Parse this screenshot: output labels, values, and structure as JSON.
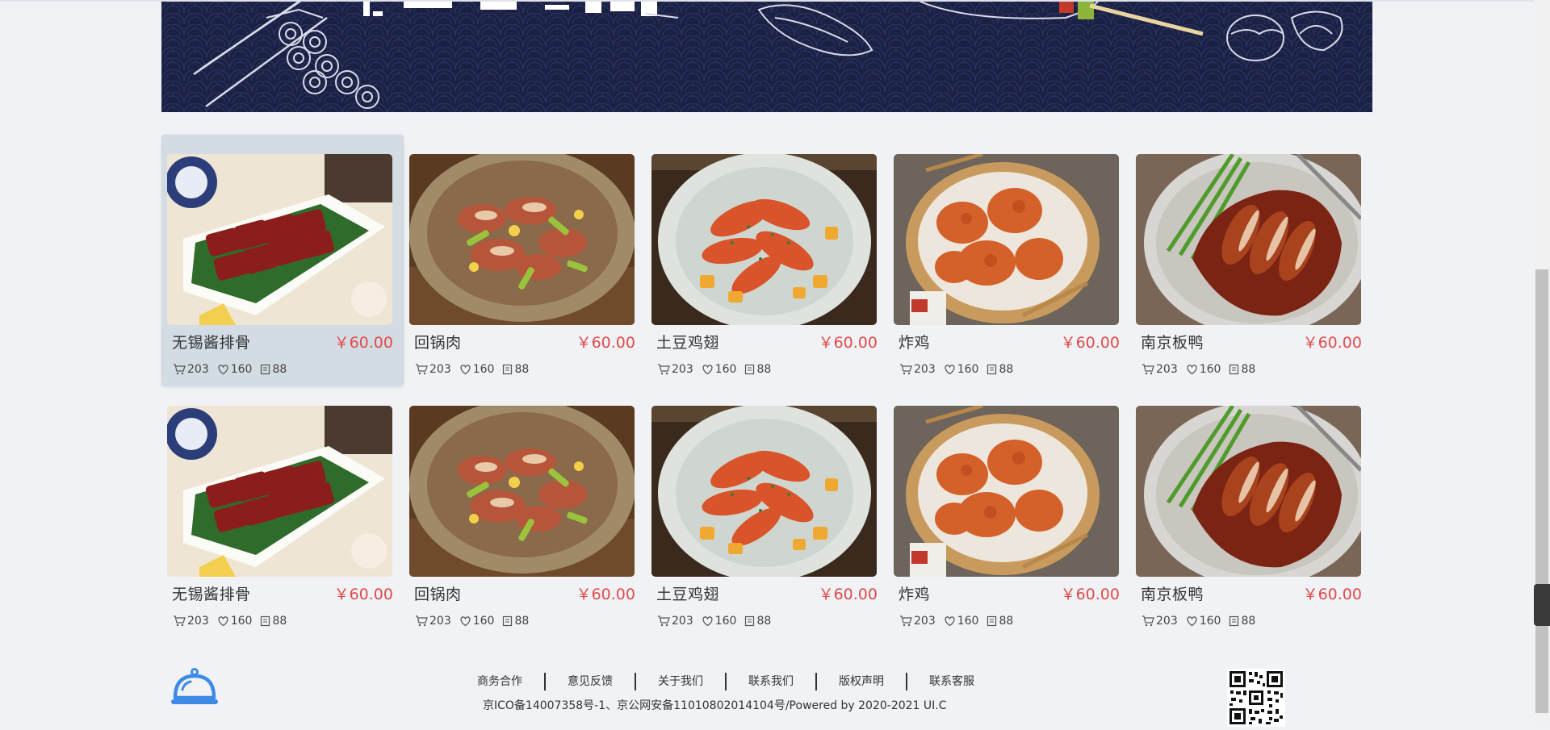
{
  "colors": {
    "price": "#e04b4b",
    "banner_bg": "#1b2143",
    "selected_card_bg": "#d3dbe3",
    "bell": "#3e8be6"
  },
  "products_row1": [
    {
      "name": "无锡酱排骨",
      "price": "￥60.00",
      "cart": "203",
      "likes": "160",
      "comments": "88",
      "image": "braised-ribs-photo"
    },
    {
      "name": "回锅肉",
      "price": "￥60.00",
      "cart": "203",
      "likes": "160",
      "comments": "88",
      "image": "twice-cooked-pork-photo"
    },
    {
      "name": "土豆鸡翅",
      "price": "￥60.00",
      "cart": "203",
      "likes": "160",
      "comments": "88",
      "image": "chicken-wings-potato-photo"
    },
    {
      "name": "炸鸡",
      "price": "￥60.00",
      "cart": "203",
      "likes": "160",
      "comments": "88",
      "image": "fried-chicken-photo"
    },
    {
      "name": "南京板鸭",
      "price": "￥60.00",
      "cart": "203",
      "likes": "160",
      "comments": "88",
      "image": "nanjing-duck-photo"
    }
  ],
  "products_row2": [
    {
      "name": "无锡酱排骨",
      "price": "￥60.00",
      "cart": "203",
      "likes": "160",
      "comments": "88",
      "image": "braised-ribs-photo"
    },
    {
      "name": "回锅肉",
      "price": "￥60.00",
      "cart": "203",
      "likes": "160",
      "comments": "88",
      "image": "twice-cooked-pork-photo"
    },
    {
      "name": "土豆鸡翅",
      "price": "￥60.00",
      "cart": "203",
      "likes": "160",
      "comments": "88",
      "image": "chicken-wings-potato-photo"
    },
    {
      "name": "炸鸡",
      "price": "￥60.00",
      "cart": "203",
      "likes": "160",
      "comments": "88",
      "image": "fried-chicken-photo"
    },
    {
      "name": "南京板鸭",
      "price": "￥60.00",
      "cart": "203",
      "likes": "160",
      "comments": "88",
      "image": "nanjing-duck-photo"
    }
  ],
  "footer": {
    "links": [
      "商务合作",
      "意见反馈",
      "关于我们",
      "联系我们",
      "版权声明",
      "联系客服"
    ],
    "copyright": "京ICO备14007358号-1、京公网安备11010802014104号/Powered by 2020-2021 UI.C"
  }
}
